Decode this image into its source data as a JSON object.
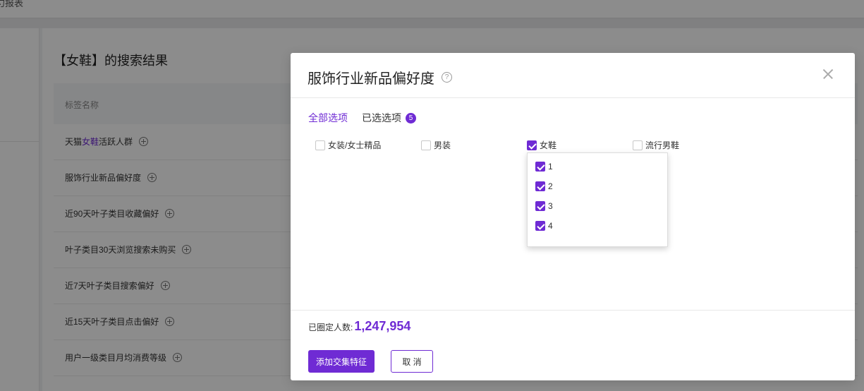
{
  "topbar": {
    "crumb": "勺报表"
  },
  "panel": {
    "title": "【女鞋】的搜索结果",
    "column_header": "标签名称",
    "rows": [
      {
        "prefix": "天猫",
        "highlight": "女鞋",
        "suffix": "活跃人群"
      },
      {
        "prefix": "服饰行业新品偏好度",
        "highlight": "",
        "suffix": ""
      },
      {
        "prefix": "近90天叶子类目收藏偏好",
        "highlight": "",
        "suffix": ""
      },
      {
        "prefix": "叶子类目30天浏览搜索未购买",
        "highlight": "",
        "suffix": ""
      },
      {
        "prefix": "近7天叶子类目搜索偏好",
        "highlight": "",
        "suffix": ""
      },
      {
        "prefix": "近15天叶子类目点击偏好",
        "highlight": "",
        "suffix": ""
      },
      {
        "prefix": "用户一级类目月均消费等级",
        "highlight": "",
        "suffix": ""
      }
    ]
  },
  "modal": {
    "title": "服饰行业新品偏好度",
    "help_icon": "?",
    "tabs": [
      {
        "label": "全部选项",
        "active": true
      },
      {
        "label": "已选选项",
        "active": false,
        "badge": "5"
      }
    ],
    "options": [
      {
        "label": "女装/女士精品",
        "checked": false
      },
      {
        "label": "男装",
        "checked": false
      },
      {
        "label": "女鞋",
        "checked": true
      },
      {
        "label": "流行男鞋",
        "checked": false
      }
    ],
    "dropdown_items": [
      {
        "label": "1",
        "checked": true
      },
      {
        "label": "2",
        "checked": true
      },
      {
        "label": "3",
        "checked": true
      },
      {
        "label": "4",
        "checked": true
      }
    ],
    "fixed_label": "已圈定人数:",
    "fixed_count": "1,247,954",
    "primary_button": "添加交集特征",
    "cancel_button": "取 消"
  },
  "colors": {
    "accent": "#6f2bd4",
    "overlay": "rgba(0,0,0,0.45)"
  }
}
